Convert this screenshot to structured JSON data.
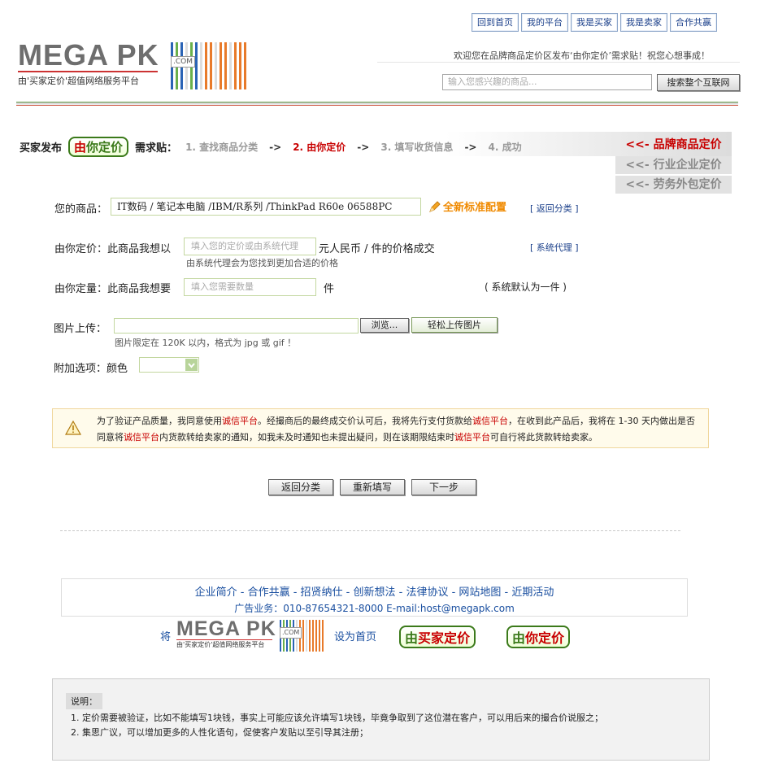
{
  "topnav": [
    "回到首页",
    "我的平台",
    "我是买家",
    "我是卖家",
    "合作共赢"
  ],
  "logo": {
    "text": "MEGA PK",
    "dotcom": ".COM",
    "tagline": "由'买家定价'超值网络服务平台"
  },
  "header": {
    "welcome": "欢迎您在品牌商品定价区发布‘由你定价’需求贴！祝您心想事成！",
    "search_placeholder": "输入您感兴趣的商品...",
    "search_button": "搜索整个互联网"
  },
  "steps": {
    "prefix": "买家发布",
    "badge_a": "由",
    "badge_b": "你定价",
    "suffix": "需求贴：",
    "items": [
      "1. 查找商品分类",
      "2. 由你定价",
      "3. 填写收货信息",
      "4. 成功"
    ],
    "arrow": "->"
  },
  "side_tabs": [
    "<<- 品牌商品定价",
    "<<- 行业企业定价",
    "<<- 劳务外包定价"
  ],
  "form": {
    "product_label": "您的商品：",
    "product_value": "IT数码 / 笔记本电脑 /IBM/R系列 /ThinkPad R60e 06588PC",
    "product_tag": "全新标准配置",
    "back_link": "[ 返回分类 ]",
    "price_label": "由你定价：此商品我想以",
    "price_placeholder": "填入您的定价或由系统代理",
    "price_suffix": "元人民币 / 件的价格成交",
    "price_hint": "由系统代理会为您找到更加合适的价格",
    "agent_link": "[ 系统代理 ]",
    "qty_label": "由你定量：此商品我想要",
    "qty_placeholder": "填入您需要数量",
    "qty_unit": "件",
    "qty_default": "( 系统默认为一件 )",
    "upload_label": "图片上传：",
    "browse_button": "浏览...",
    "upload_button": "轻松上传图片",
    "upload_hint": "图片限定在 120K 以内，格式为 jpg 或 gif ！",
    "option_label": "附加选项：颜色"
  },
  "notice": {
    "p1": "为了验证产品质量，我同意使用",
    "h1": "诚信平台",
    "p2": "。经撮商后的最终成交价认可后，我将先行支付货款给",
    "h2": "诚信平台",
    "p3": "，在收到此产品后，我将在 1-30 天内做出是否同意将",
    "h3": "诚信平台",
    "p4": "内货款转给卖家的通知，如我未及时通知也未提出疑问，则在该期限结束时",
    "h4": "诚信平台",
    "p5": "可自行将此货款转给卖家。"
  },
  "actions": [
    "返回分类",
    "重新填写",
    "下一步"
  ],
  "footer": {
    "links": "企业简介 - 合作共赢 - 招贤纳仕 - 创新想法 - 法律协议 - 网站地图 - 近期活动",
    "contact": "广告业务：010-87654321-8000 E-mail:host@megapk.com",
    "set_prefix": "将",
    "set_suffix": "设为首页",
    "badge1_a": "由",
    "badge1_b": "买家定价",
    "badge2_a": "由",
    "badge2_b": "你定价"
  },
  "note": {
    "title": "说明：",
    "lines": [
      "1. 定价需要被验证，比如不能填写1块钱，事实上可能应该允许填写1块钱，毕竟争取到了这位潜在客户，可以用后来的撮合价说服之；",
      "2. 集思广议，可以增加更多的人性化语句，促使客户发贴以至引导其注册；"
    ]
  },
  "colors": {
    "accent_red": "#c80000",
    "link_blue": "#1a3f8a",
    "brand_green": "#3b7a1a"
  }
}
